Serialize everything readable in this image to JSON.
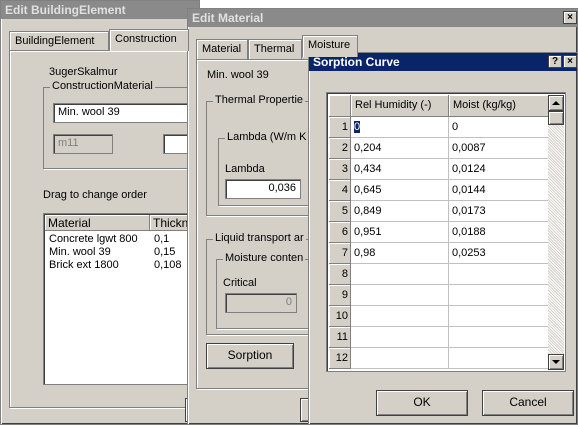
{
  "window1": {
    "title": "Edit BuildingElement",
    "tabs": [
      "BuildingElement",
      "Construction"
    ],
    "element_name": "3ugerSkalmur",
    "group_label": "ConstructionMaterial",
    "material_value": "Min. wool 39",
    "code_value": "m11",
    "drag_label": "Drag to change order",
    "columns": [
      "Material",
      "Thickn"
    ],
    "rows": [
      {
        "material": "Concrete lgwt 800",
        "thickness": "0,1"
      },
      {
        "material": "Min. wool 39",
        "thickness": "0,15"
      },
      {
        "material": "Brick ext 1800",
        "thickness": "0,108"
      }
    ]
  },
  "window2": {
    "title": "Edit Material",
    "tabs": [
      "Material",
      "Thermal",
      "Moisture"
    ],
    "material_name": "Min. wool 39",
    "thermal_group": "Thermal Propertie",
    "lambda_group": "Lambda (W/m K",
    "lambda_label": "Lambda",
    "lambda_value": "0,036",
    "liquid_group": "Liquid transport ar",
    "moisture_group": "Moisture conten",
    "critical_label": "Critical",
    "critical_value": "0",
    "sorption_button": "Sorption",
    "close_glyph": "×"
  },
  "dialog": {
    "title": "Sorption Curve",
    "help_glyph": "?",
    "close_glyph": "×",
    "columns": [
      "Rel Humidity (-)",
      "Moist (kg/kg)"
    ],
    "rows": [
      {
        "n": "1",
        "rh": "0",
        "moist": "0"
      },
      {
        "n": "2",
        "rh": "0,204",
        "moist": "0,0087"
      },
      {
        "n": "3",
        "rh": "0,434",
        "moist": "0,0124"
      },
      {
        "n": "4",
        "rh": "0,645",
        "moist": "0,0144"
      },
      {
        "n": "5",
        "rh": "0,849",
        "moist": "0,0173"
      },
      {
        "n": "6",
        "rh": "0,951",
        "moist": "0,0188"
      },
      {
        "n": "7",
        "rh": "0,98",
        "moist": "0,0253"
      },
      {
        "n": "8",
        "rh": "",
        "moist": ""
      },
      {
        "n": "9",
        "rh": "",
        "moist": ""
      },
      {
        "n": "10",
        "rh": "",
        "moist": ""
      },
      {
        "n": "11",
        "rh": "",
        "moist": ""
      },
      {
        "n": "12",
        "rh": "",
        "moist": ""
      }
    ],
    "ok_button": "OK",
    "cancel_button": "Cancel"
  }
}
